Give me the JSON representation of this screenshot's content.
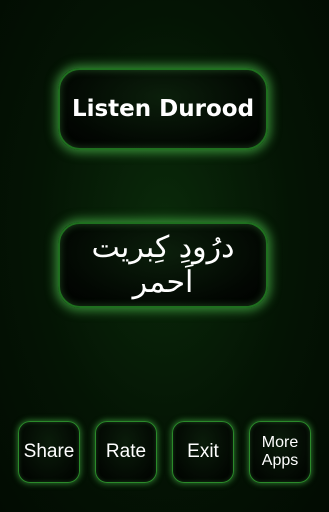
{
  "main": {
    "listen_label": "Listen Durood",
    "durood_label": "درُودِ کِبریت اَحمر"
  },
  "footer": {
    "share_label": "Share",
    "rate_label": "Rate",
    "exit_label": "Exit",
    "more_apps_label": "More\nApps"
  },
  "colors": {
    "glow": "#5adc5a",
    "background": "#041404",
    "text": "#ffffff"
  }
}
